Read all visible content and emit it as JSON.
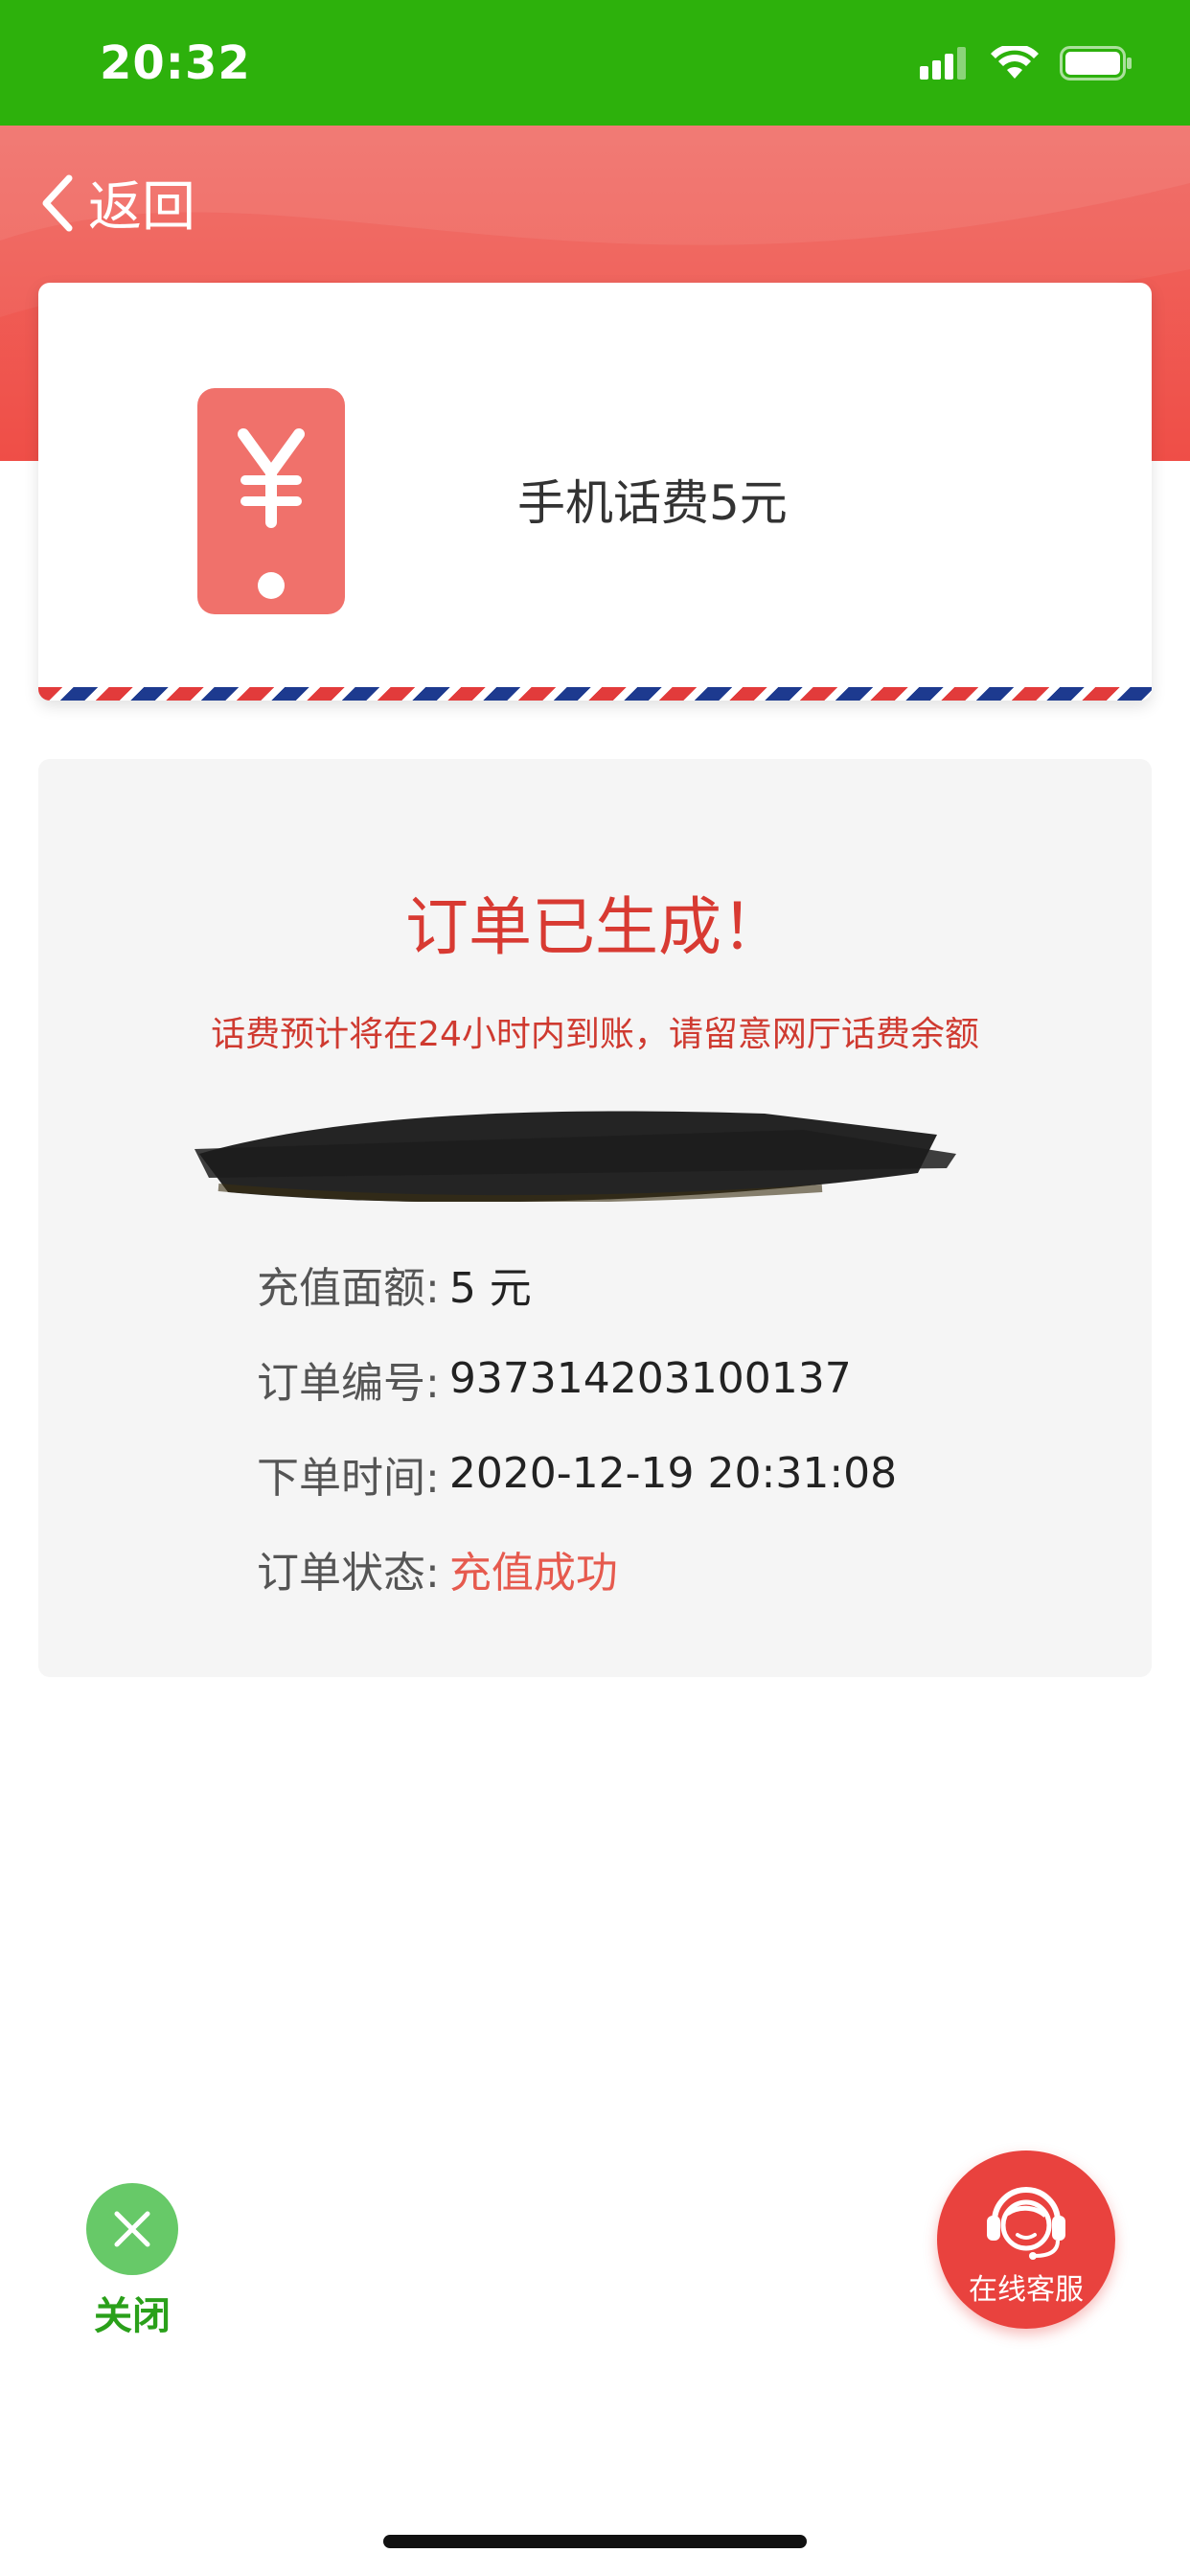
{
  "status_bar": {
    "time": "20:32",
    "icons": [
      "cellular-signal-icon",
      "wifi-icon",
      "battery-icon"
    ]
  },
  "header": {
    "back_label": "返回",
    "colors": {
      "top": "#f06a63",
      "bottom": "#ef4e47"
    }
  },
  "product": {
    "icon": "phone-yen-icon",
    "name": "手机话费5元"
  },
  "order": {
    "title": "订单已生成！",
    "notice": "话费预计将在24小时内到账，请留意网厅话费余额",
    "rows": [
      {
        "key": "充值面额:",
        "value": "5 元"
      },
      {
        "key": "订单编号:",
        "value": "937314203100137"
      },
      {
        "key": "下单时间:",
        "value": "2020-12-19 20:31:08"
      },
      {
        "key": "订单状态:",
        "value": "充值成功"
      }
    ]
  },
  "actions": {
    "close_label": "关闭",
    "service_label": "在线客服"
  },
  "colors": {
    "brand_green": "#2db10c",
    "accent_red": "#e9423e",
    "success_text": "#e65a4e"
  }
}
